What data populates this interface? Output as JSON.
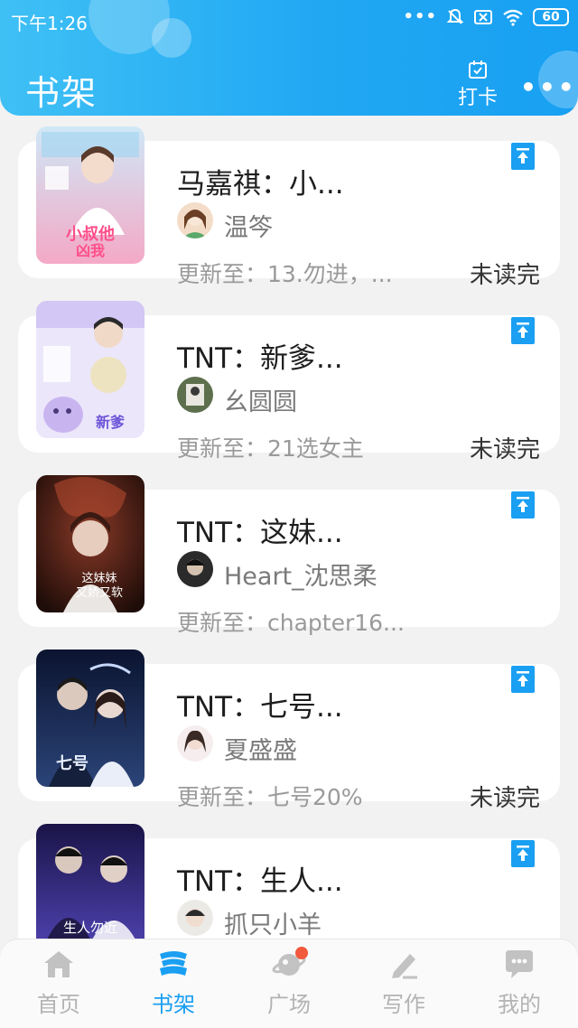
{
  "status_bar": {
    "time": "下午1:26",
    "dots": "•••",
    "battery": "60"
  },
  "header": {
    "title": "书架",
    "checkin_label": "打卡",
    "more_label": "•••"
  },
  "books": [
    {
      "title": "马嘉祺：小...",
      "author": "温笒",
      "update": "更新至：13.勿进，...",
      "status": "未读完",
      "cover_colors": [
        "#f2a6c8",
        "#9fd3f0"
      ]
    },
    {
      "title": "TNT：新爹...",
      "author": "幺圆圆",
      "update": "更新至：21选女主",
      "status": "未读完",
      "cover_colors": [
        "#dcd3f5",
        "#a68fe0"
      ]
    },
    {
      "title": "TNT：这妹...",
      "author": "Heart_沈思柔",
      "update": "更新至：chapter16...",
      "status": "",
      "cover_colors": [
        "#3a1a14",
        "#c0503a"
      ]
    },
    {
      "title": "TNT：七号...",
      "author": "夏盛盛",
      "update": "更新至：七号20%",
      "status": "未读完",
      "cover_colors": [
        "#0f1a3a",
        "#4a6aa8"
      ]
    },
    {
      "title": "TNT：生人...",
      "author": "抓只小羊",
      "update": "",
      "status": "",
      "cover_colors": [
        "#1b1750",
        "#6a5ac8"
      ]
    }
  ],
  "tabs": [
    {
      "label": "首页",
      "icon": "home-icon",
      "active": false
    },
    {
      "label": "书架",
      "icon": "bookshelf-icon",
      "active": true
    },
    {
      "label": "广场",
      "icon": "planet-icon",
      "active": false
    },
    {
      "label": "写作",
      "icon": "pen-icon",
      "active": false
    },
    {
      "label": "我的",
      "icon": "chat-icon",
      "active": false
    }
  ],
  "colors": {
    "accent": "#1a9ff2",
    "header_start": "#3fc0f5",
    "header_end": "#18a0f2",
    "badge": "#f15a3c"
  }
}
